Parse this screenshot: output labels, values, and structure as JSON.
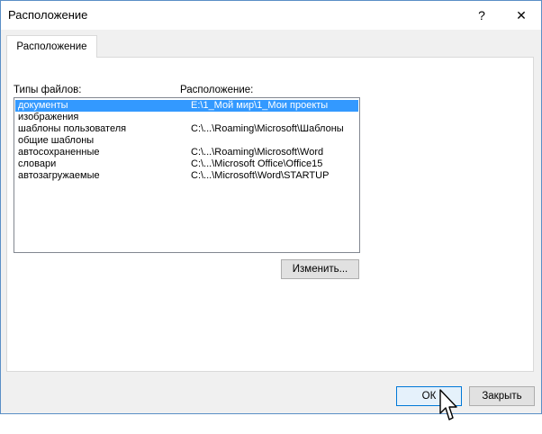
{
  "window": {
    "title": "Расположение",
    "help_label": "?",
    "close_label": "✕"
  },
  "tab": {
    "label": "Расположение"
  },
  "columns": {
    "file_types": "Типы файлов:",
    "location": "Расположение:"
  },
  "rows": [
    {
      "type": "документы",
      "path": "E:\\1_Мой мир\\1_Мои проекты",
      "selected": true
    },
    {
      "type": "изображения",
      "path": ""
    },
    {
      "type": "шаблоны пользователя",
      "path": "C:\\...\\Roaming\\Microsoft\\Шаблоны"
    },
    {
      "type": "общие шаблоны",
      "path": ""
    },
    {
      "type": "автосохраненные",
      "path": "C:\\...\\Roaming\\Microsoft\\Word"
    },
    {
      "type": "словари",
      "path": "C:\\...\\Microsoft Office\\Office15"
    },
    {
      "type": "автозагружаемые",
      "path": "C:\\...\\Microsoft\\Word\\STARTUP"
    }
  ],
  "buttons": {
    "change": "Изменить...",
    "ok": "ОК",
    "close": "Закрыть"
  },
  "colors": {
    "selection": "#3399ff",
    "window_border": "#5a8fc6"
  },
  "icons": {
    "cursor": "arrow-cursor-icon"
  }
}
